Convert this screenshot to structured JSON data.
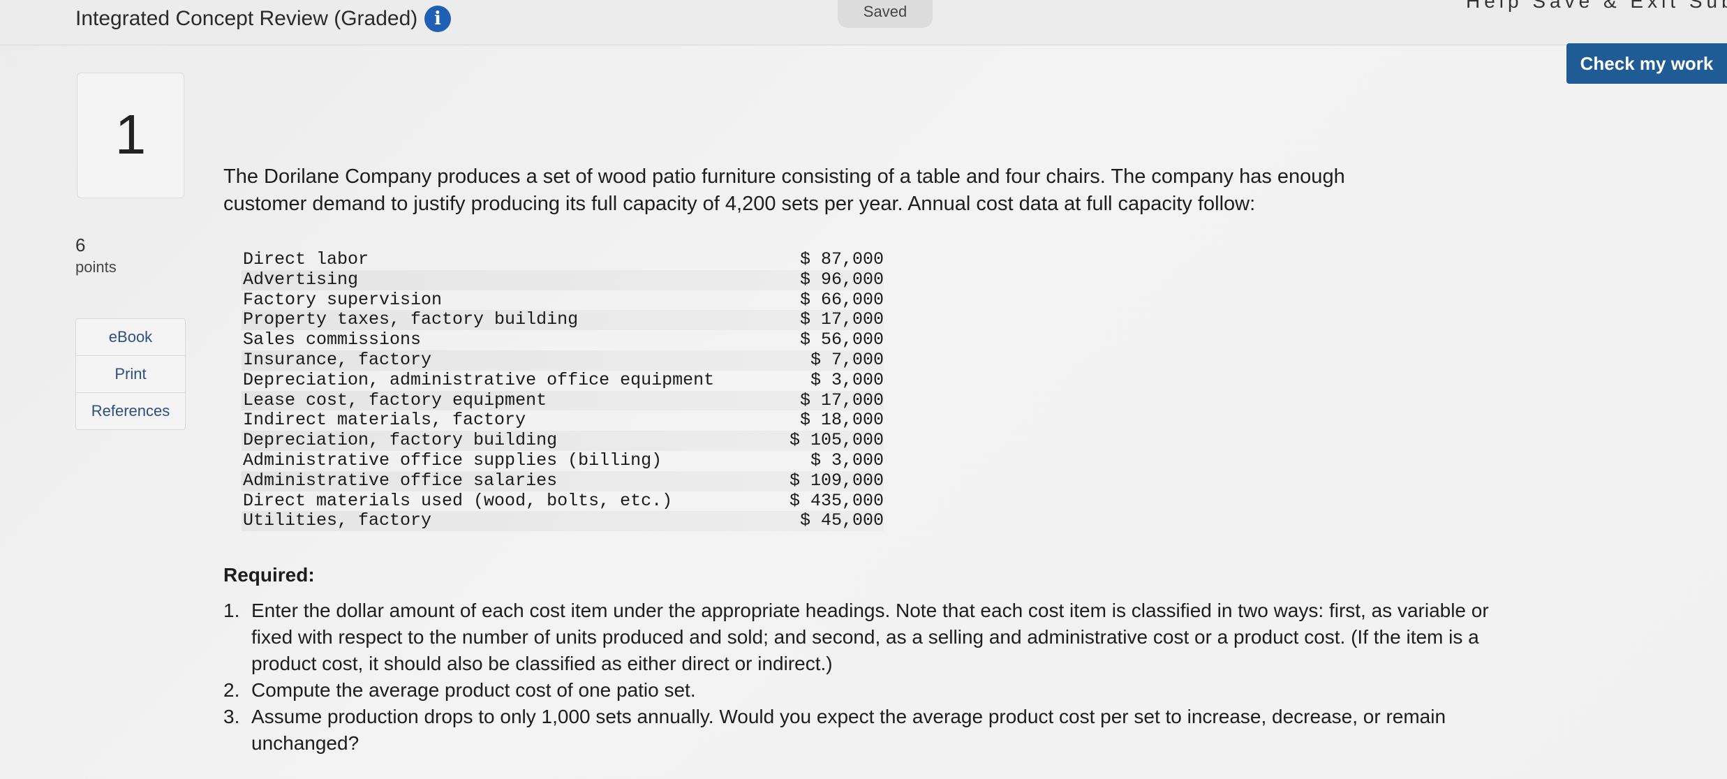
{
  "header": {
    "title": "Integrated Concept Review (Graded)",
    "info_icon": "i",
    "saved_label": "Saved",
    "top_links": "Help   Save & Exit   Submit",
    "check_button": "Check my work"
  },
  "question": {
    "number": "1",
    "points_value": "6",
    "points_label": "points"
  },
  "sidebar": {
    "items": [
      {
        "label": "eBook"
      },
      {
        "label": "Print"
      },
      {
        "label": "References"
      }
    ]
  },
  "content": {
    "intro": "The Dorilane Company produces a set of wood patio furniture consisting of a table and four chairs. The company has enough customer demand to justify producing its full capacity of 4,200 sets per year. Annual cost data at full capacity follow:",
    "cost_items": [
      {
        "label": "Direct labor",
        "amount": "$ 87,000"
      },
      {
        "label": "Advertising",
        "amount": "$ 96,000"
      },
      {
        "label": "Factory supervision",
        "amount": "$ 66,000"
      },
      {
        "label": "Property taxes, factory building",
        "amount": "$ 17,000"
      },
      {
        "label": "Sales commissions",
        "amount": "$ 56,000"
      },
      {
        "label": "Insurance, factory",
        "amount": "$ 7,000"
      },
      {
        "label": "Depreciation, administrative office equipment",
        "amount": "$ 3,000"
      },
      {
        "label": "Lease cost, factory equipment",
        "amount": "$ 17,000"
      },
      {
        "label": "Indirect materials, factory",
        "amount": "$ 18,000"
      },
      {
        "label": "Depreciation, factory building",
        "amount": "$ 105,000"
      },
      {
        "label": "Administrative office supplies (billing)",
        "amount": "$ 3,000"
      },
      {
        "label": "Administrative office salaries",
        "amount": "$ 109,000"
      },
      {
        "label": "Direct materials used (wood, bolts, etc.)",
        "amount": "$ 435,000"
      },
      {
        "label": "Utilities, factory",
        "amount": "$ 45,000"
      }
    ],
    "required_heading": "Required:",
    "required_items": [
      {
        "num": "1.",
        "text": "Enter the dollar amount of each cost item under the appropriate headings. Note that each cost item is classified in two ways: first, as variable or fixed with respect to the number of units produced and sold; and second, as a selling and administrative cost or a product cost. (If the item is a product cost, it should also be classified as either direct or indirect.)"
      },
      {
        "num": "2.",
        "text": "Compute the average product cost of one patio set."
      },
      {
        "num": "3.",
        "text": "Assume production drops to only 1,000 sets annually. Would you expect the average product cost per set to increase, decrease, or remain unchanged?"
      }
    ]
  }
}
